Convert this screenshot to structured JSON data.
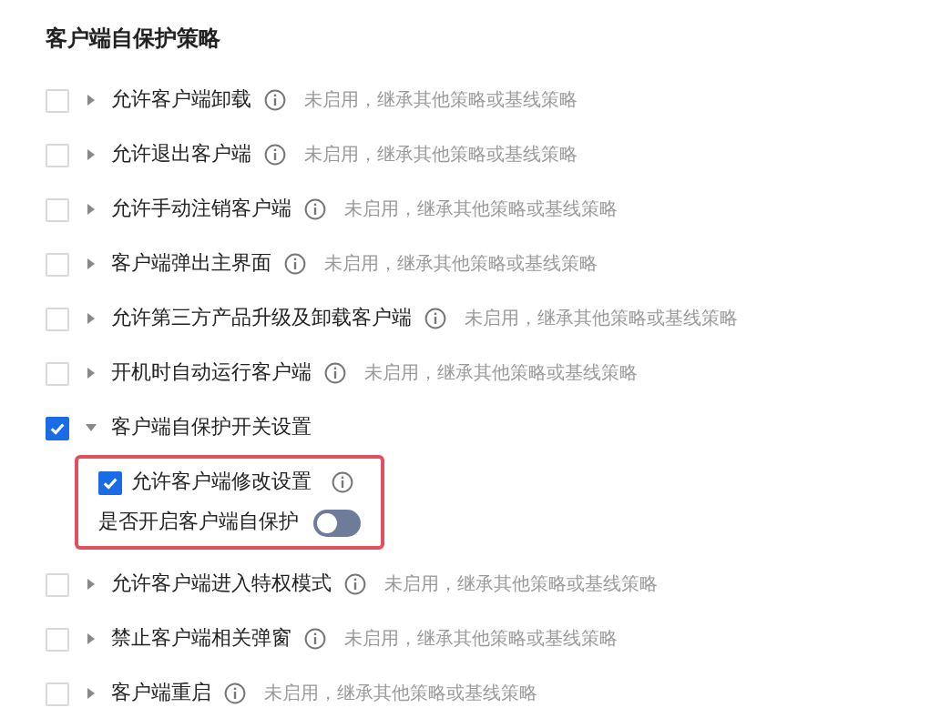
{
  "title": "客户端自保护策略",
  "rules": [
    {
      "kind": "rule",
      "label": "允许客户端卸载",
      "info": true,
      "note": "未启用，继承其他策略或基线策略",
      "checked": false,
      "expanded": false
    },
    {
      "kind": "rule",
      "label": "允许退出客户端",
      "info": true,
      "note": "未启用，继承其他策略或基线策略",
      "checked": false,
      "expanded": false
    },
    {
      "kind": "rule",
      "label": "允许手动注销客户端",
      "info": true,
      "note": "未启用，继承其他策略或基线策略",
      "checked": false,
      "expanded": false
    },
    {
      "kind": "rule",
      "label": "客户端弹出主界面",
      "info": true,
      "note": "未启用，继承其他策略或基线策略",
      "checked": false,
      "expanded": false
    },
    {
      "kind": "rule",
      "label": "允许第三方产品升级及卸载客户端",
      "info": true,
      "note": "未启用，继承其他策略或基线策略",
      "checked": false,
      "expanded": false
    },
    {
      "kind": "rule",
      "label": "开机时自动运行客户端",
      "info": true,
      "note": "未启用，继承其他策略或基线策略",
      "checked": false,
      "expanded": false
    },
    {
      "kind": "rule",
      "label": "客户端自保护开关设置",
      "info": false,
      "checked": true,
      "expanded": true,
      "highlighted": true,
      "children": [
        {
          "kind": "checkbox",
          "label": "允许客户端修改设置",
          "info": true,
          "checked": true
        },
        {
          "kind": "switch",
          "label": "是否开启客户端自保护",
          "on": false
        }
      ]
    },
    {
      "kind": "rule",
      "label": "允许客户端进入特权模式",
      "info": true,
      "note": "未启用，继承其他策略或基线策略",
      "checked": false,
      "expanded": false
    },
    {
      "kind": "rule",
      "label": "禁止客户端相关弹窗",
      "info": true,
      "note": "未启用，继承其他策略或基线策略",
      "checked": false,
      "expanded": false
    },
    {
      "kind": "rule",
      "label": "客户端重启",
      "info": true,
      "note": "未启用，继承其他策略或基线策略",
      "checked": false,
      "expanded": false
    }
  ]
}
